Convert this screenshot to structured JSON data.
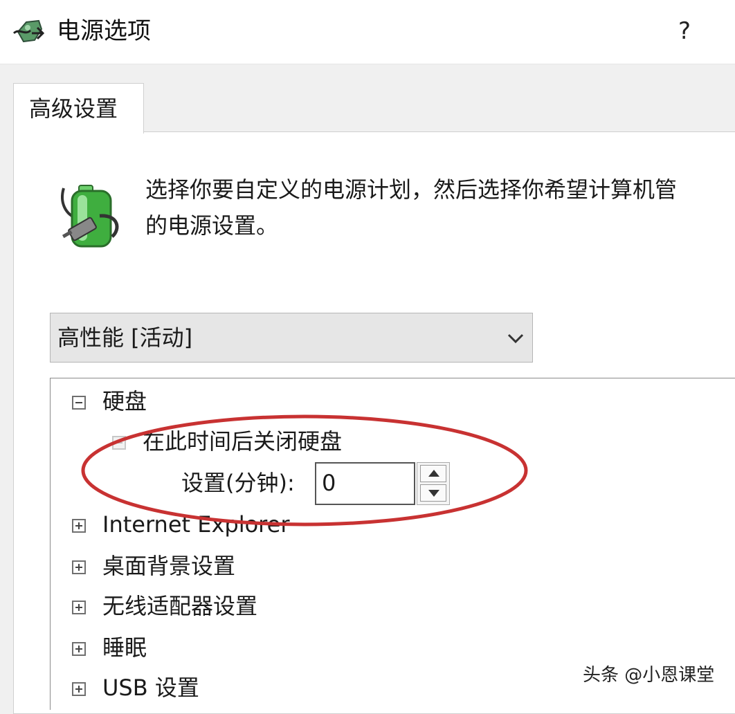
{
  "window": {
    "title": "电源选项",
    "help_label": "?"
  },
  "tabs": [
    {
      "label": "高级设置"
    }
  ],
  "description": {
    "line1": "选择你要自定义的电源计划，然后选择你希望计算机管",
    "line2": "的电源设置。"
  },
  "plan_dropdown": {
    "selected": "高性能 [活动]"
  },
  "tree": {
    "hard_disk": "硬盘",
    "turn_off_disk": "在此时间后关闭硬盘",
    "setting_label": "设置(分钟):",
    "setting_value": "0",
    "items": [
      "Internet Explorer",
      "桌面背景设置",
      "无线适配器设置",
      "睡眠",
      "USB 设置"
    ]
  },
  "colors": {
    "highlight_ellipse": "#c83232",
    "battery_green": "#3fae3f"
  },
  "icons": {
    "app": "power-options-icon",
    "battery": "battery-plug-icon"
  },
  "watermark": "头条 @小恩课堂"
}
